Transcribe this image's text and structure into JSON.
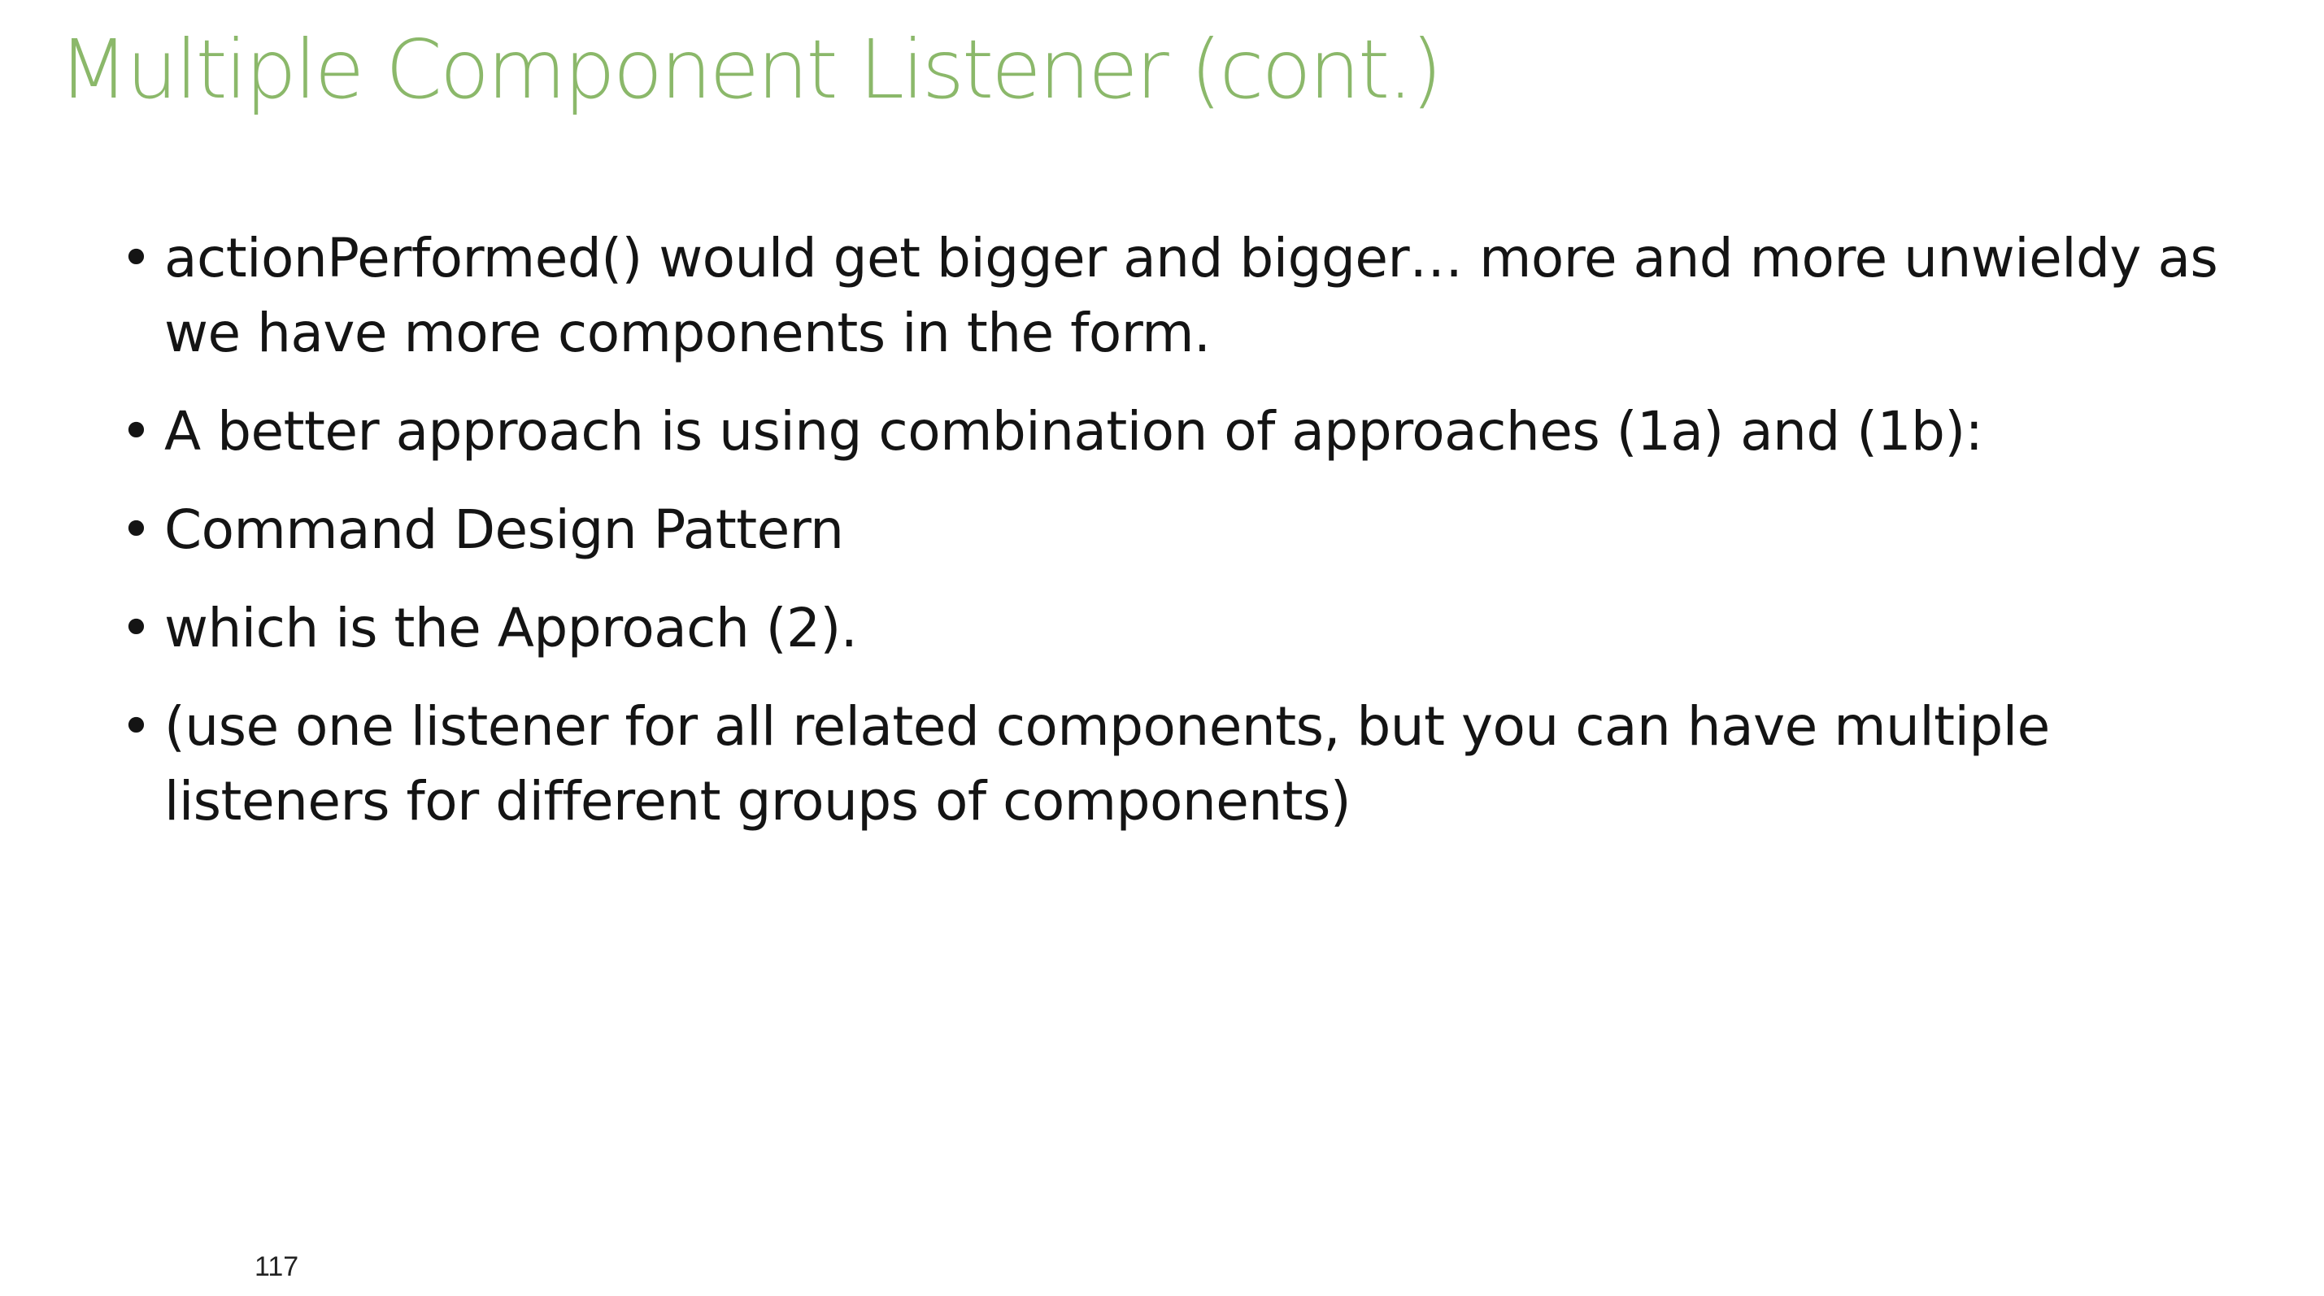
{
  "slide": {
    "title": "Multiple Component Listener (cont.)",
    "title_color": "#8bb86a",
    "text_color": "#141414",
    "bullet_glyph": "•",
    "bullets": [
      {
        "text": "actionPerformed() would get bigger and bigger… more and more unwieldy as we have more components in the form."
      },
      {
        "text": "A better approach is using combination of approaches (1a) and (1b):"
      },
      {
        "text": "Command Design Pattern"
      },
      {
        "text": "which is the Approach (2)."
      },
      {
        "text": "(use one listener for all related components, but you can have multiple listeners for different groups of components)"
      }
    ],
    "page_number": "117"
  }
}
